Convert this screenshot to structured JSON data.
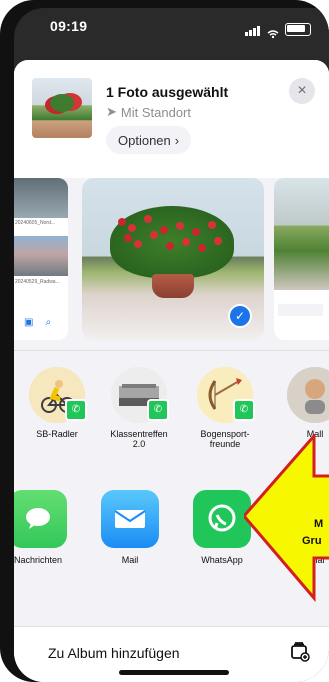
{
  "status": {
    "time": "09:19"
  },
  "share": {
    "title": "1 Foto ausgewählt",
    "subtitle": "Mit Standort",
    "options_label": "Optionen",
    "close_label": "×"
  },
  "photos": {
    "left_top_label": "20240605_Nord...",
    "left_bottom_label": "20240529_Radwa..."
  },
  "people": [
    {
      "label": "SB-Radler"
    },
    {
      "label": "Klassentreffen 2.0"
    },
    {
      "label": "Bogensport-freunde"
    },
    {
      "label": "Mall"
    }
  ],
  "apps": [
    {
      "label": "Nachrichten"
    },
    {
      "label": "Mail"
    },
    {
      "label": "WhatsApp"
    },
    {
      "label": "Signal"
    }
  ],
  "bottom": {
    "action_label": "Zu Album hinzufügen"
  },
  "overlay": {
    "line1": "M",
    "line2": "Gru"
  },
  "colors": {
    "accent": "#1c74e9",
    "whatsapp": "#20c65a",
    "messages": "#34c759",
    "mail": "#1b8cf5",
    "signal": "#2f61e8",
    "arrow_fill": "#f7f700",
    "arrow_stroke": "#d21f1f"
  }
}
